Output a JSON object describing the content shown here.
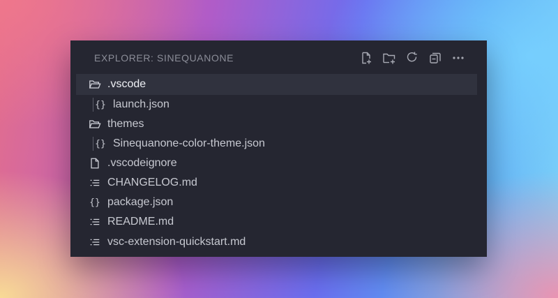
{
  "explorer": {
    "title": "EXPLORER: SINEQUANONE",
    "actions": [
      {
        "name": "new-file-icon"
      },
      {
        "name": "new-folder-icon"
      },
      {
        "name": "refresh-icon"
      },
      {
        "name": "collapse-all-icon"
      },
      {
        "name": "more-icon"
      }
    ],
    "items": [
      {
        "label": ".vscode",
        "icon": "folder-open-icon",
        "depth": 0,
        "selected": true
      },
      {
        "label": "launch.json",
        "icon": "json-braces-icon",
        "depth": 1
      },
      {
        "label": "themes",
        "icon": "folder-open-icon",
        "depth": 0
      },
      {
        "label": "Sinequanone-color-theme.json",
        "icon": "json-braces-icon",
        "depth": 1
      },
      {
        "label": ".vscodeignore",
        "icon": "file-icon",
        "depth": 0
      },
      {
        "label": "CHANGELOG.md",
        "icon": "markdown-list-icon",
        "depth": 0
      },
      {
        "label": "package.json",
        "icon": "json-braces-icon",
        "depth": 0
      },
      {
        "label": "README.md",
        "icon": "markdown-list-icon",
        "depth": 0
      },
      {
        "label": "vsc-extension-quickstart.md",
        "icon": "markdown-list-icon",
        "depth": 0
      }
    ]
  }
}
